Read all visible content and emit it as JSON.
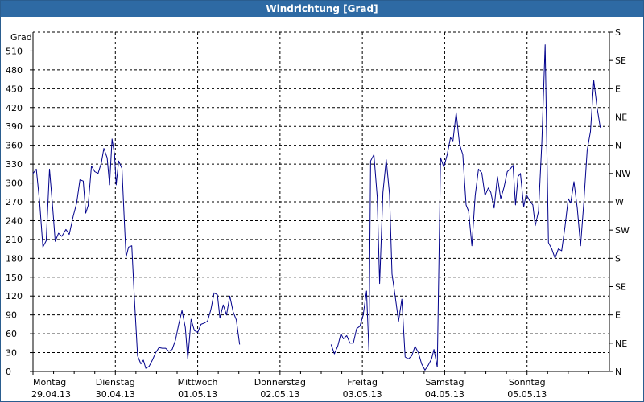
{
  "window": {
    "title": "Windrichtung [Grad]"
  },
  "chart_data": {
    "type": "line",
    "title": "Windrichtung [Grad]",
    "ylabel": "Grad",
    "ylim": [
      0,
      540
    ],
    "grid": true,
    "y_ticks": [
      0,
      30,
      60,
      90,
      120,
      150,
      180,
      210,
      240,
      270,
      300,
      330,
      360,
      390,
      420,
      450,
      480,
      510
    ],
    "y2_labels": [
      "N",
      "NE",
      "E",
      "SE",
      "S",
      "SW",
      "W",
      "NW",
      "N",
      "NE",
      "E",
      "SE",
      "S"
    ],
    "x_labels": [
      {
        "day": "Montag",
        "date": "29.04.13"
      },
      {
        "day": "Dienstag",
        "date": "30.04.13"
      },
      {
        "day": "Mittwoch",
        "date": "01.05.13"
      },
      {
        "day": "Donnerstag",
        "date": "02.05.13"
      },
      {
        "day": "Freitag",
        "date": "03.05.13"
      },
      {
        "day": "Samstag",
        "date": "04.05.13"
      },
      {
        "day": "Sonntag",
        "date": "05.05.13"
      }
    ],
    "xlim": [
      0,
      7
    ],
    "series": [
      {
        "color": "#00008b",
        "segments": [
          [
            [
              0,
              315
            ],
            [
              0.04,
              322
            ],
            [
              0.08,
              270
            ],
            [
              0.12,
              198
            ],
            [
              0.16,
              208
            ],
            [
              0.2,
              322
            ],
            [
              0.24,
              260
            ],
            [
              0.27,
              207
            ],
            [
              0.31,
              220
            ],
            [
              0.35,
              215
            ],
            [
              0.4,
              226
            ],
            [
              0.44,
              218
            ],
            [
              0.49,
              248
            ],
            [
              0.53,
              268
            ],
            [
              0.57,
              305
            ],
            [
              0.61,
              303
            ],
            [
              0.64,
              252
            ],
            [
              0.67,
              264
            ],
            [
              0.71,
              327
            ],
            [
              0.75,
              318
            ],
            [
              0.79,
              315
            ],
            [
              0.83,
              332
            ],
            [
              0.86,
              355
            ],
            [
              0.9,
              340
            ],
            [
              0.93,
              297
            ],
            [
              0.96,
              370
            ],
            [
              0.99,
              345
            ],
            [
              1.01,
              297
            ],
            [
              1.04,
              335
            ],
            [
              1.08,
              323
            ],
            [
              1.11,
              238
            ],
            [
              1.13,
              182
            ],
            [
              1.16,
              198
            ],
            [
              1.2,
              200
            ],
            [
              1.23,
              120
            ],
            [
              1.27,
              25
            ],
            [
              1.31,
              12
            ],
            [
              1.34,
              18
            ],
            [
              1.37,
              5
            ],
            [
              1.41,
              8
            ],
            [
              1.45,
              18
            ],
            [
              1.49,
              30
            ],
            [
              1.53,
              38
            ],
            [
              1.57,
              37
            ],
            [
              1.61,
              37
            ],
            [
              1.65,
              32
            ],
            [
              1.69,
              35
            ],
            [
              1.73,
              50
            ],
            [
              1.77,
              75
            ],
            [
              1.81,
              97
            ],
            [
              1.85,
              70
            ],
            [
              1.88,
              20
            ],
            [
              1.92,
              83
            ],
            [
              1.96,
              65
            ],
            [
              2.0,
              62
            ],
            [
              2.04,
              75
            ],
            [
              2.08,
              77
            ],
            [
              2.12,
              80
            ],
            [
              2.16,
              98
            ],
            [
              2.2,
              125
            ],
            [
              2.24,
              122
            ],
            [
              2.27,
              85
            ],
            [
              2.31,
              106
            ],
            [
              2.35,
              90
            ],
            [
              2.39,
              120
            ],
            [
              2.43,
              95
            ],
            [
              2.47,
              82
            ],
            [
              2.51,
              43
            ]
          ],
          [
            [
              3.62,
              43
            ],
            [
              3.66,
              28
            ],
            [
              3.7,
              40
            ],
            [
              3.74,
              60
            ],
            [
              3.77,
              52
            ],
            [
              3.81,
              57
            ],
            [
              3.85,
              45
            ],
            [
              3.89,
              45
            ],
            [
              3.93,
              68
            ],
            [
              3.97,
              72
            ],
            [
              4.01,
              90
            ],
            [
              4.05,
              128
            ],
            [
              4.08,
              32
            ],
            [
              4.1,
              335
            ],
            [
              4.14,
              345
            ],
            [
              4.18,
              278
            ],
            [
              4.21,
              140
            ],
            [
              4.25,
              285
            ],
            [
              4.29,
              337
            ],
            [
              4.33,
              282
            ],
            [
              4.36,
              155
            ],
            [
              4.4,
              118
            ],
            [
              4.44,
              80
            ],
            [
              4.48,
              115
            ],
            [
              4.52,
              23
            ],
            [
              4.56,
              20
            ],
            [
              4.6,
              25
            ],
            [
              4.64,
              40
            ],
            [
              4.68,
              30
            ],
            [
              4.72,
              12
            ],
            [
              4.76,
              2
            ],
            [
              4.8,
              10
            ],
            [
              4.84,
              20
            ],
            [
              4.87,
              35
            ],
            [
              4.91,
              7
            ],
            [
              4.95,
              340
            ],
            [
              4.99,
              325
            ],
            [
              5.03,
              345
            ],
            [
              5.07,
              372
            ],
            [
              5.1,
              367
            ],
            [
              5.14,
              412
            ],
            [
              5.18,
              362
            ],
            [
              5.22,
              345
            ],
            [
              5.26,
              265
            ],
            [
              5.29,
              255
            ],
            [
              5.33,
              200
            ],
            [
              5.37,
              280
            ],
            [
              5.41,
              322
            ],
            [
              5.45,
              316
            ],
            [
              5.49,
              280
            ],
            [
              5.53,
              292
            ],
            [
              5.56,
              285
            ],
            [
              5.6,
              260
            ],
            [
              5.64,
              310
            ],
            [
              5.68,
              275
            ],
            [
              5.72,
              293
            ],
            [
              5.76,
              318
            ],
            [
              5.8,
              323
            ],
            [
              5.83,
              328
            ],
            [
              5.86,
              265
            ],
            [
              5.89,
              310
            ],
            [
              5.92,
              315
            ],
            [
              5.96,
              262
            ],
            [
              5.99,
              282
            ],
            [
              6.03,
              272
            ],
            [
              6.07,
              265
            ],
            [
              6.1,
              232
            ],
            [
              6.14,
              255
            ],
            [
              6.18,
              365
            ],
            [
              6.22,
              520
            ],
            [
              6.26,
              205
            ],
            [
              6.3,
              195
            ],
            [
              6.34,
              180
            ],
            [
              6.38,
              195
            ],
            [
              6.42,
              192
            ],
            [
              6.46,
              230
            ],
            [
              6.5,
              275
            ],
            [
              6.53,
              268
            ],
            [
              6.57,
              302
            ],
            [
              6.61,
              260
            ],
            [
              6.65,
              200
            ],
            [
              6.69,
              270
            ],
            [
              6.73,
              352
            ],
            [
              6.77,
              382
            ],
            [
              6.81,
              463
            ],
            [
              6.85,
              420
            ],
            [
              6.89,
              388
            ]
          ]
        ]
      }
    ]
  }
}
